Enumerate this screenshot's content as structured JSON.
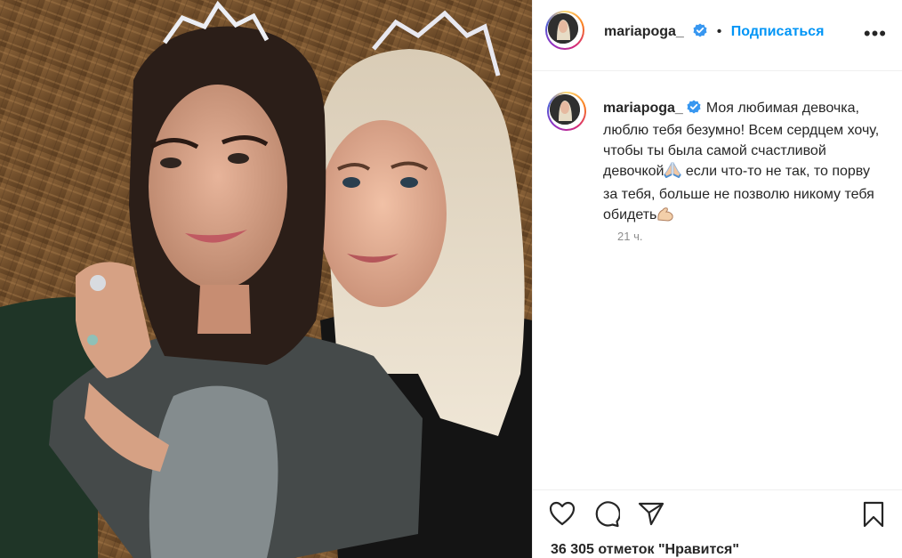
{
  "post": {
    "username": "mariapoga_",
    "follow_label": "Подписаться",
    "more_label": "•••",
    "separator": "•",
    "caption": "Моя любимая девочка, люблю тебя безумно! Всем сердцем хочу, чтобы ты была самой счастливой девочкой",
    "caption_part2": "если что-то не так, то порву за тебя, больше не позволю никому тебя обидеть",
    "time_ago": "21 ч.",
    "likes_text": "36 305 отметок \"Нравится\""
  },
  "icons": {
    "verified": "verified-badge-icon",
    "like": "heart-icon",
    "comment": "comment-icon",
    "share": "paper-plane-icon",
    "save": "bookmark-icon",
    "emoji1": "folded-hands-emoji",
    "emoji2": "flexed-biceps-emoji"
  },
  "colors": {
    "accent": "#0095f6",
    "text": "#262626",
    "muted": "#8e8e8e",
    "verified": "#3897f0"
  }
}
